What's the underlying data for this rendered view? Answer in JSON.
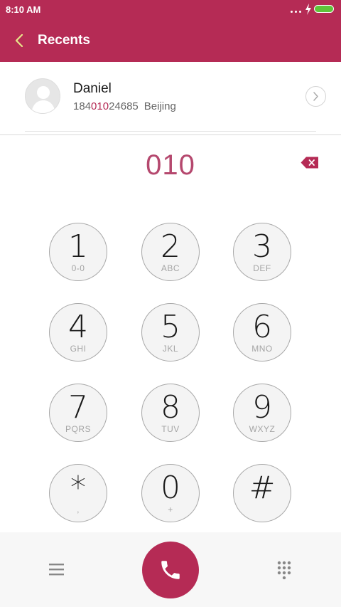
{
  "status_bar": {
    "time": "8:10 AM"
  },
  "header": {
    "title": "Recents"
  },
  "recent": {
    "name": "Daniel",
    "number_prefix": "184",
    "number_match": "010",
    "number_suffix": "24685",
    "location": "Beijing"
  },
  "dialer": {
    "number": "010",
    "keys": [
      {
        "digit": "1",
        "letters": "0-0"
      },
      {
        "digit": "2",
        "letters": "ABC"
      },
      {
        "digit": "3",
        "letters": "DEF"
      },
      {
        "digit": "4",
        "letters": "GHI"
      },
      {
        "digit": "5",
        "letters": "JKL"
      },
      {
        "digit": "6",
        "letters": "MNO"
      },
      {
        "digit": "7",
        "letters": "PQRS"
      },
      {
        "digit": "8",
        "letters": "TUV"
      },
      {
        "digit": "9",
        "letters": "WXYZ"
      },
      {
        "digit": "*",
        "letters": ","
      },
      {
        "digit": "0",
        "letters": "+"
      },
      {
        "digit": "#",
        "letters": ""
      }
    ]
  },
  "colors": {
    "accent": "#b52b55",
    "number_text": "#b5486e",
    "battery": "#5fc33a",
    "key_fill": "#f4f4f4",
    "bottom_bar": "#f7f7f7"
  },
  "icons": {
    "back": "chevron-left-icon",
    "delete": "backspace-icon",
    "detail": "chevron-right-icon",
    "menu": "menu-icon",
    "call": "phone-icon",
    "keypad": "dialpad-icon"
  }
}
